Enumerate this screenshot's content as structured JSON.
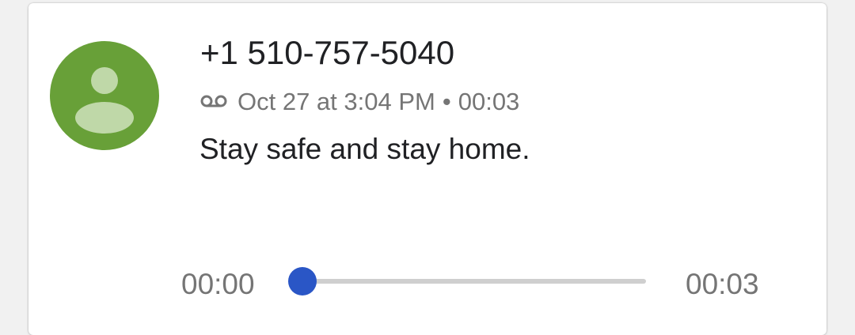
{
  "call": {
    "number": "+1 510-757-5040",
    "date_time": "Oct 27 at 3:04 PM",
    "separator": "•",
    "duration": "00:03",
    "type_icon": "voicemail-icon",
    "avatar_icon": "person-icon",
    "avatar_color": "#68a038"
  },
  "transcript": "Stay safe and stay home.",
  "player": {
    "current_time": "00:00",
    "total_time": "00:03",
    "progress": 0,
    "accent_color": "#2a56c6"
  }
}
